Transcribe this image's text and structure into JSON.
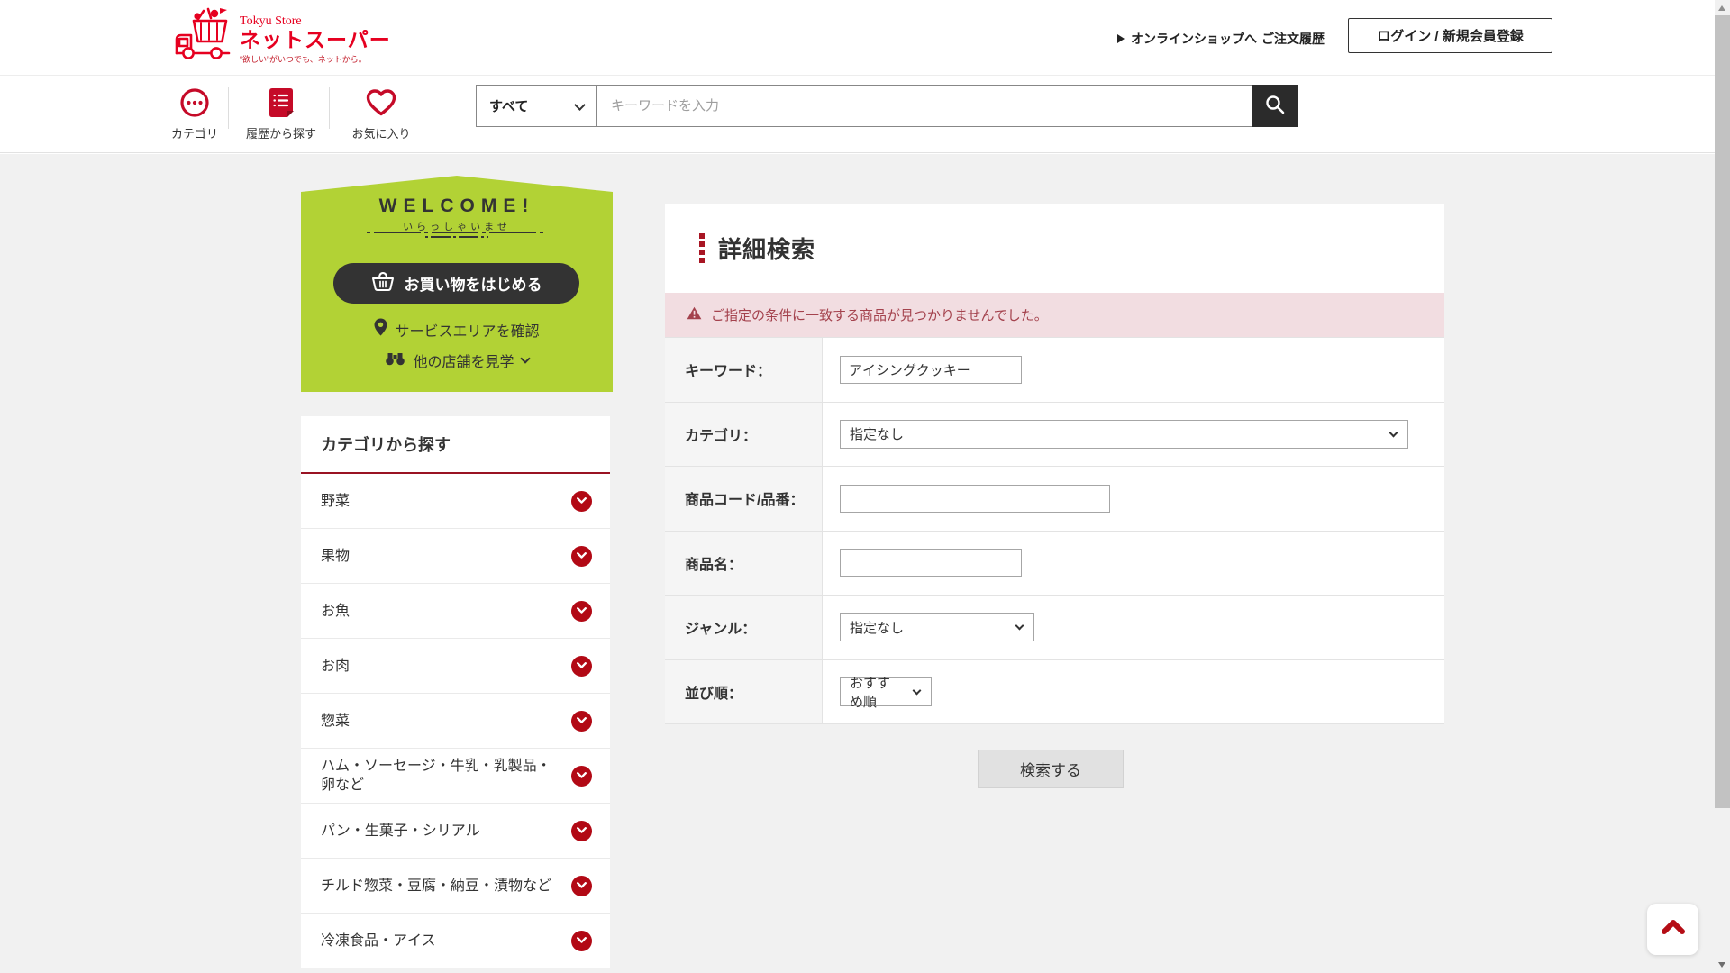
{
  "brand": {
    "store_name": "Tokyu Store",
    "service_name": "ネットスーパー",
    "tagline": "“欲しい”がいつでも、ネットから。"
  },
  "header": {
    "online_shop_link": "オンラインショップへ",
    "order_history_link": "ご注文履歴",
    "login_button": "ログイン / 新規会員登録"
  },
  "nav": {
    "category_label": "カテゴリ",
    "history_label": "履歴から探す",
    "favorites_label": "お気に入り",
    "search_scope_value": "すべて",
    "search_placeholder": "キーワードを入力"
  },
  "welcome": {
    "title": "WELCOME!",
    "subtitle": "いらっしゃいませ",
    "start_button": "お買い物をはじめる",
    "service_area_link": "サービスエリアを確認",
    "other_stores_link": "他の店舗を見学"
  },
  "category_panel": {
    "title": "カテゴリから探す",
    "items": [
      "野菜",
      "果物",
      "お魚",
      "お肉",
      "惣菜",
      "ハム・ソーセージ・牛乳・乳製品・卵など",
      "パン・生菓子・シリアル",
      "チルド惣菜・豆腐・納豆・漬物など",
      "冷凍食品・アイス"
    ]
  },
  "detail_search": {
    "title": "詳細検索",
    "error_message": "ご指定の条件に一致する商品が見つかりませんでした。",
    "fields": [
      {
        "label": "キーワード：",
        "value": "アイシングクッキー"
      },
      {
        "label": "カテゴリ：",
        "value": "指定なし"
      },
      {
        "label": "商品コード/品番：",
        "value": ""
      },
      {
        "label": "商品名：",
        "value": ""
      },
      {
        "label": "ジャンル：",
        "value": "指定なし"
      },
      {
        "label": "並び順：",
        "value": "おすすめ順"
      }
    ],
    "submit_label": "検索する"
  },
  "colors": {
    "brand_red": "#e60020",
    "icon_red": "#c50a28",
    "dark_red_circle": "#b20915",
    "accent_green": "#b2d235",
    "dark": "#333333",
    "error_bg": "#f2dde1",
    "error_text": "#a4424d"
  }
}
